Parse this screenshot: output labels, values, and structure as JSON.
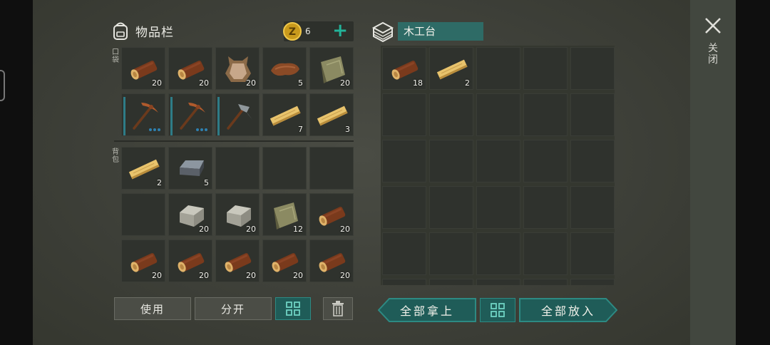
{
  "inventory": {
    "title": "物品栏",
    "pocket_label": "口袋",
    "backpack_label": "背包",
    "coins": "6",
    "pocket": [
      {
        "icon": "log-icon",
        "count": "20"
      },
      {
        "icon": "log-icon",
        "count": "20"
      },
      {
        "icon": "leather-hide-icon",
        "count": "20"
      },
      {
        "icon": "leather-icon",
        "count": "5"
      },
      {
        "icon": "cloth-icon",
        "count": "20"
      },
      {
        "icon": "pickaxe-icon",
        "count": "",
        "durability": true,
        "dots": 3
      },
      {
        "icon": "pickaxe-icon",
        "count": "",
        "durability": true,
        "dots": 3
      },
      {
        "icon": "stone-pickaxe-icon",
        "count": "",
        "durability": true,
        "dots": 0
      },
      {
        "icon": "plank-icon",
        "count": "7"
      },
      {
        "icon": "plank-icon",
        "count": "3"
      }
    ],
    "backpack": [
      {
        "icon": "plank-icon",
        "count": "2"
      },
      {
        "icon": "iron-ingot-icon",
        "count": "5"
      },
      {
        "icon": "",
        "count": ""
      },
      {
        "icon": "",
        "count": ""
      },
      {
        "icon": "",
        "count": ""
      },
      {
        "icon": "",
        "count": ""
      },
      {
        "icon": "stone-icon",
        "count": "20"
      },
      {
        "icon": "stone-icon",
        "count": "20"
      },
      {
        "icon": "cloth-icon",
        "count": "12"
      },
      {
        "icon": "log-icon",
        "count": "20"
      },
      {
        "icon": "log-icon",
        "count": "20"
      },
      {
        "icon": "log-icon",
        "count": "20"
      },
      {
        "icon": "log-icon",
        "count": "20"
      },
      {
        "icon": "log-icon",
        "count": "20"
      },
      {
        "icon": "log-icon",
        "count": "20"
      }
    ]
  },
  "bench": {
    "title": "木工台",
    "slots": [
      {
        "icon": "log-icon",
        "count": "18"
      },
      {
        "icon": "plank-icon",
        "count": "2"
      }
    ]
  },
  "buttons": {
    "use": "使用",
    "split": "分开",
    "take_all": "全部拿上",
    "put_all": "全部放入"
  },
  "close": {
    "label": "关闭"
  },
  "colors": {
    "accent": "#2e6b66",
    "teal_text": "#22b39a",
    "durability": "#2e7c87"
  }
}
